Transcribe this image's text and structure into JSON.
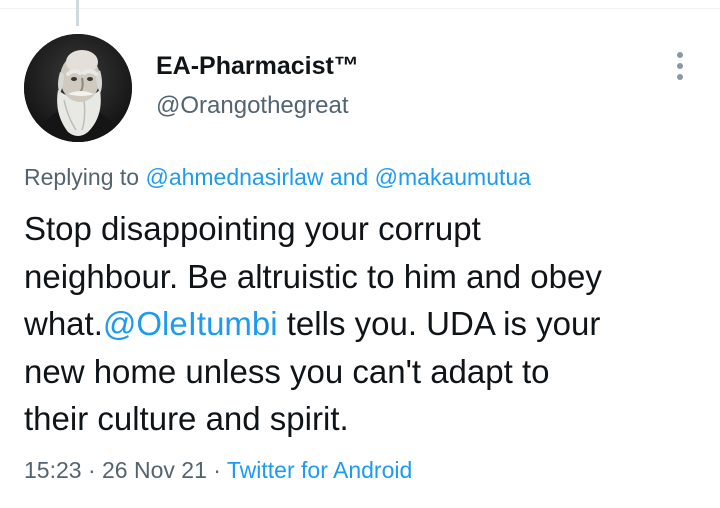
{
  "tweet": {
    "author": {
      "display_name": "EA-Pharmacist™",
      "handle": "@Orangothegreat"
    },
    "more_icon": "more-vertical-icon",
    "replying": {
      "prefix": "Replying to ",
      "first": "@ahmednasirlaw",
      "and": " and ",
      "second": "@makaumutua"
    },
    "text": {
      "line1": "Stop disappointing your corrupt",
      "line2": "neighbour. Be altruistic to him and obey",
      "line3_pre": "what.",
      "line3_mention": "@OleItumbi",
      "line3_post": " tells you. UDA is your",
      "line4": "new home unless you can't adapt to",
      "line5": "their culture and spirit."
    },
    "meta": {
      "time": "15:23",
      "sep1": " · ",
      "date": "26 Nov 21",
      "sep2": " · ",
      "source": "Twitter for Android"
    }
  },
  "colors": {
    "link": "#1d9bf0",
    "secondary_text": "#536471",
    "primary_text": "#0f1419"
  }
}
